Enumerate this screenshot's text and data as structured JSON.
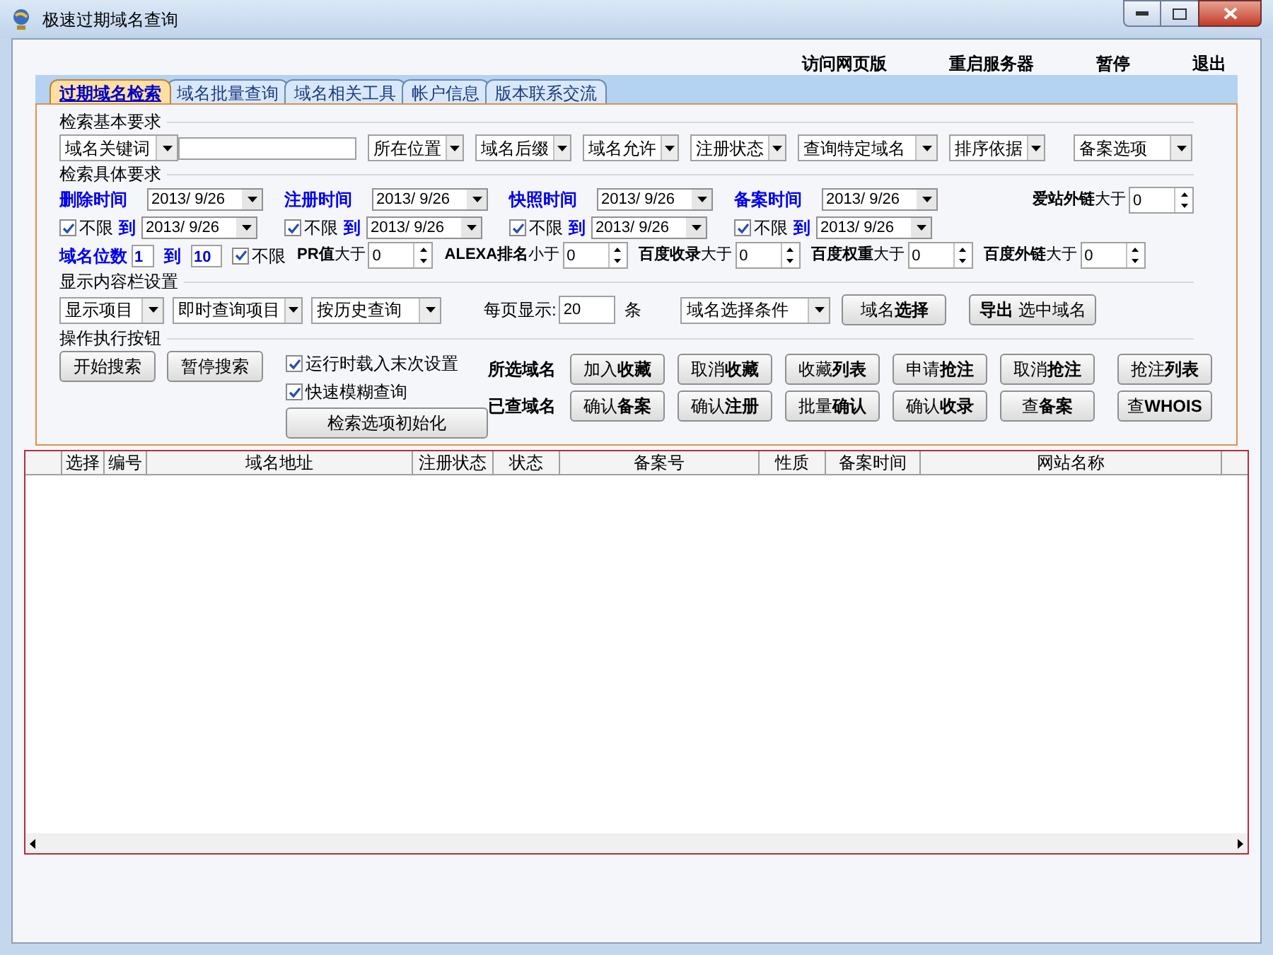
{
  "window": {
    "title": "极速过期域名查询"
  },
  "top_links": [
    "访问网页版",
    "重启服务器",
    "暂停",
    "退出"
  ],
  "tabs": [
    {
      "label": "过期域名检索",
      "selected": true
    },
    {
      "label": "域名批量查询",
      "selected": false
    },
    {
      "label": "域名相关工具",
      "selected": false
    },
    {
      "label": "帐户信息",
      "selected": false
    },
    {
      "label": "版本联系交流",
      "selected": false
    }
  ],
  "basic": {
    "heading": "检索基本要求",
    "keyword_combo": "域名关键词",
    "combos": [
      "所在位置",
      "域名后缀",
      "域名允许",
      "注册状态",
      "查询特定域名",
      "排序依据",
      "备案选项"
    ]
  },
  "specific": {
    "heading": "检索具体要求",
    "dates": [
      {
        "label": "删除时间",
        "from": "2013/ 9/26",
        "unlimited": "不限",
        "checked": true,
        "to_label": "到",
        "to": "2013/ 9/26"
      },
      {
        "label": "注册时间",
        "from": "2013/ 9/26",
        "unlimited": "不限",
        "checked": true,
        "to_label": "到",
        "to": "2013/ 9/26"
      },
      {
        "label": "快照时间",
        "from": "2013/ 9/26",
        "unlimited": "不限",
        "checked": true,
        "to_label": "到",
        "to": "2013/ 9/26"
      },
      {
        "label": "备案时间",
        "from": "2013/ 9/26",
        "unlimited": "不限",
        "checked": true,
        "to_label": "到",
        "to": "2013/ 9/26"
      }
    ],
    "top_spinner": {
      "label": "**爱站外链**大于",
      "value": "0"
    },
    "digits": {
      "label": "域名位数",
      "from": "1",
      "to_label": "到",
      "to": "10",
      "unlimited": "不限",
      "checked": true
    },
    "spinners": [
      {
        "label": "**PR值**大于",
        "value": "0"
      },
      {
        "label": "**ALEXA排名**小于",
        "value": "0"
      },
      {
        "label": "**百度收录**大于",
        "value": "0"
      },
      {
        "label": "**百度权重**大于",
        "value": "0"
      },
      {
        "label": "**百度外链**大于",
        "value": "0"
      }
    ]
  },
  "display": {
    "heading": "显示内容栏设置",
    "combos": [
      "显示项目",
      "即时查询项目",
      "按历史查询"
    ],
    "per_page_label": "每页显示:",
    "per_page": "20",
    "unit": "条",
    "select_combo": "域名选择条件",
    "buttons": [
      "域名**选择**",
      "**导出** 选中域名"
    ]
  },
  "actions": {
    "heading": "操作执行按钮",
    "buttons": [
      "开始搜索",
      "暂停搜索"
    ],
    "checks": [
      {
        "label": "运行时载入末次设置",
        "checked": true
      },
      {
        "label": "快速模糊查询",
        "checked": true
      }
    ],
    "reset": "检索选项初始化",
    "groups": [
      {
        "label": "所选域名",
        "buttons": [
          "加入**收藏**",
          "取消**收藏**",
          "收藏**列表**",
          "申请**抢注**",
          "取消**抢注**",
          "抢注**列表**"
        ]
      },
      {
        "label": "已查域名",
        "buttons": [
          "确认**备案**",
          "确认**注册**",
          "批量**确认**",
          "确认**收录**",
          "查**备案**",
          "查**WHOIS**"
        ]
      }
    ]
  },
  "table": {
    "columns": [
      "选择",
      "编号",
      "域名地址",
      "注册状态",
      "状态",
      "备案号",
      "性质",
      "备案时间",
      "网站名称"
    ]
  }
}
